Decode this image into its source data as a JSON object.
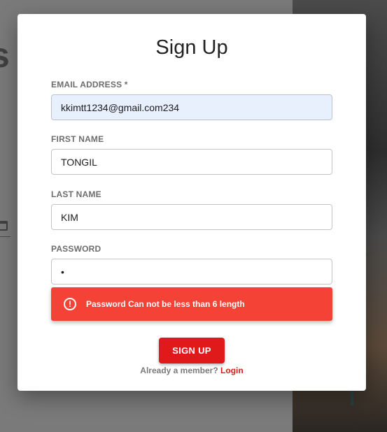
{
  "background": {
    "heading_fragment": "s",
    "calendar_icon": "calendar-icon"
  },
  "modal": {
    "title": "Sign Up",
    "fields": {
      "email": {
        "label": "EMAIL ADDRESS *",
        "value": "kkimtt1234@gmail.com234"
      },
      "first_name": {
        "label": "FIRST NAME",
        "value": "TONGIL"
      },
      "last_name": {
        "label": "LAST NAME",
        "value": "KIM"
      },
      "password": {
        "label": "PASSWORD",
        "value": "•"
      }
    },
    "alert": {
      "icon": "alert-circle-icon",
      "glyph": "!",
      "message": "Password Can not be less than 6 length",
      "color": "#f44336"
    },
    "submit_label": "SIGN UP",
    "member_prompt": "Already a member?",
    "login_label": "Login",
    "accent_color": "#e01a1a"
  }
}
